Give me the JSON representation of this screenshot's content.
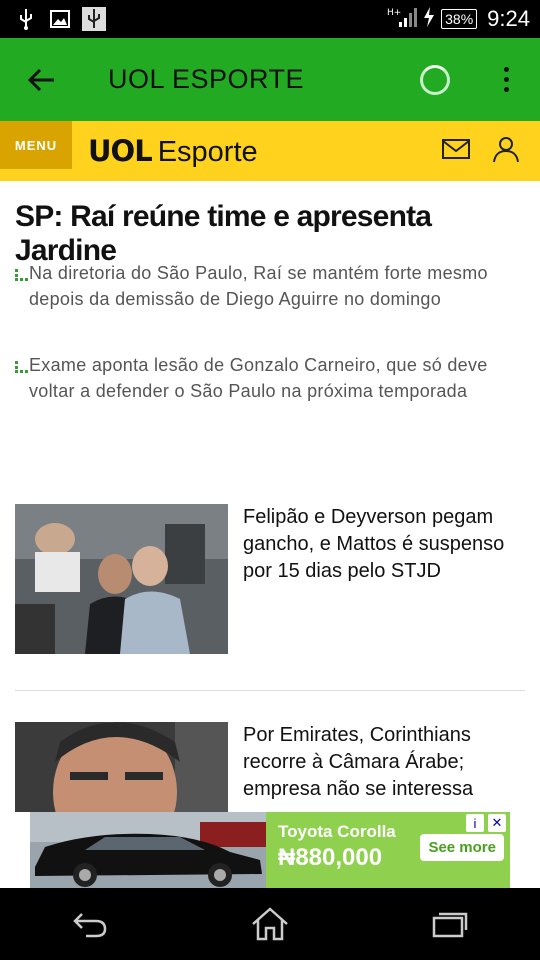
{
  "status_bar": {
    "battery": "38%",
    "time": "9:24",
    "left_icons": [
      "usb-icon",
      "image-icon",
      "usb-debug-icon"
    ],
    "right_icons": [
      "hplus-signal-icon",
      "charging-bolt-icon",
      "battery-icon"
    ]
  },
  "app_bar": {
    "title": "UOL ESPORTE",
    "back_icon": "arrow-left-icon",
    "loading_icon": "spinner-icon",
    "overflow_icon": "kebab-icon"
  },
  "brand_bar": {
    "menu_label": "MENU",
    "logo_main": "UOL",
    "logo_secondary": "Esporte",
    "icons": [
      "mail-icon",
      "user-icon"
    ]
  },
  "main_story": {
    "headline": "SP: Raí reúne time e apresenta Jardine",
    "subitems": [
      "Na diretoria do São Paulo, Raí se mantém forte mesmo depois da demissão de Diego Aguirre no domingo",
      "Exame aponta lesão de Gonzalo Carneiro, que só deve voltar a defender o São Paulo na próxima temporada"
    ]
  },
  "stories": [
    {
      "title": "Felipão e Deyverson pegam gancho, e Mattos é suspenso por 15 dias pelo STJD"
    },
    {
      "title": "Por Emirates, Corinthians recorre à Câmara Árabe; empresa não se interessa"
    }
  ],
  "ad": {
    "product": "Toyota Corolla",
    "price": "₦880,000",
    "cta": "See more",
    "info": "i",
    "close": "✕",
    "bg_color": "#8fd14f"
  },
  "nav_bar": {
    "icons": [
      "back-icon",
      "home-icon",
      "recents-icon"
    ]
  },
  "colors": {
    "app_bar": "#22aa22",
    "brand_bar": "#ffd21e",
    "menu": "#d9a400"
  }
}
